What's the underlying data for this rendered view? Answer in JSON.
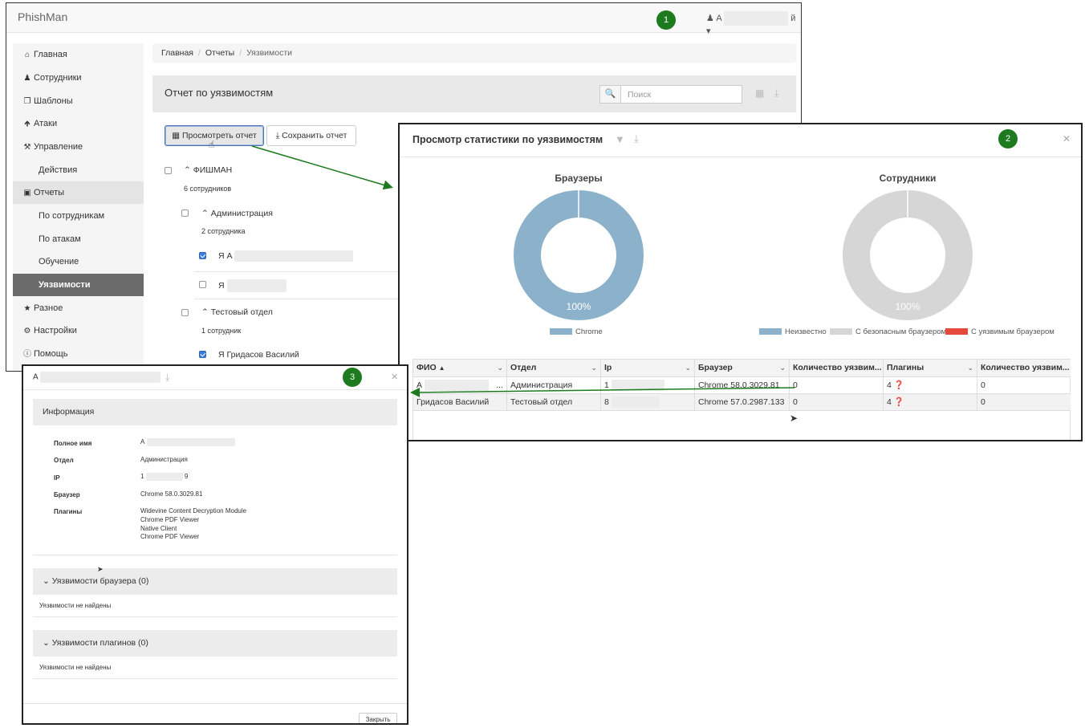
{
  "badges": [
    "1",
    "2",
    "3"
  ],
  "window1": {
    "brand": "PhishMan",
    "user": {
      "prefix": "A",
      "suffix": "й"
    },
    "sidebar": {
      "items": [
        {
          "label": "Главная",
          "icon": "home-icon"
        },
        {
          "label": "Сотрудники",
          "icon": "users-icon"
        },
        {
          "label": "Шаблоны",
          "icon": "templates-icon"
        },
        {
          "label": "Атаки",
          "icon": "arrow-up-icon"
        },
        {
          "label": "Управление",
          "icon": "wrench-icon"
        },
        {
          "label": "Действия"
        },
        {
          "label": "Отчеты",
          "icon": "book-icon"
        },
        {
          "label": "По сотрудникам"
        },
        {
          "label": "По атакам"
        },
        {
          "label": "Обучение"
        },
        {
          "label": "Уязвимости"
        },
        {
          "label": "Разное",
          "icon": "star-icon"
        },
        {
          "label": "Настройки",
          "icon": "cogs-icon"
        },
        {
          "label": "Помощь",
          "icon": "info-icon"
        }
      ]
    },
    "breadcrumb": [
      "Главная",
      "Отчеты",
      "Уязвимости"
    ],
    "panel_title": "Отчет по уязвимостям",
    "search_placeholder": "Поиск",
    "buttons": {
      "view": "Просмотреть отчет",
      "save": "Сохранить отчет"
    },
    "tree": {
      "org": "ФИШМАН",
      "org_count": "6 сотрудников",
      "dept1": "Администрация",
      "dept1_count": "2 сотрудника",
      "user1_prefix": "А",
      "dept2": "Тестовый отдел",
      "dept2_count": "1 сотрудник",
      "user3": "Гридасов Василий"
    }
  },
  "window2": {
    "title": "Просмотр статистики по уязвимостям",
    "chart_data": [
      {
        "type": "pie",
        "title": "Браузеры",
        "categories": [
          "Chrome"
        ],
        "values": [
          100
        ],
        "label": "100%",
        "colors": [
          "#8cb2cb"
        ]
      },
      {
        "type": "pie",
        "title": "Сотрудники",
        "categories": [
          "Неизвестно",
          "С безопасным браузером",
          "С уязвимым браузером"
        ],
        "values": [
          0,
          100,
          0
        ],
        "label": "100%",
        "colors": [
          "#8cb2cb",
          "#d6d6d6",
          "#e8483a"
        ]
      }
    ],
    "table": {
      "columns": [
        "ФИО",
        "Отдел",
        "Ip",
        "Браузер",
        "Количество уязвим...",
        "Плагины",
        "Количество уязвим..."
      ],
      "sort_indicator": "▲",
      "rows": [
        [
          "А",
          "Администрация",
          "1",
          "Chrome 58.0.3029.81",
          "0",
          "4",
          "0"
        ],
        [
          "Гридасов Василий",
          "Тестовый отдел",
          "8",
          "Chrome 57.0.2987.133",
          "0",
          "4",
          "0"
        ]
      ],
      "ellipsis": "..."
    }
  },
  "window3": {
    "title_prefix": "А",
    "info_section": "Информация",
    "fields": [
      {
        "key": "Полное имя",
        "value": "А"
      },
      {
        "key": "Отдел",
        "value": "Администрация"
      },
      {
        "key": "IP",
        "value": "1"
      },
      {
        "key": "Браузер",
        "value": "Chrome 58.0.3029.81"
      },
      {
        "key": "Плагины",
        "value": ""
      }
    ],
    "ip_suffix": "9",
    "plugins": [
      "Widevine Content Decryption Module",
      "Chrome PDF Viewer",
      "Native Client",
      "Chrome PDF Viewer"
    ],
    "browser_vulns": "Уязвимости браузера (0)",
    "plugin_vulns": "Уязвимости плагинов (0)",
    "none_found": "Уязвимости не найдены",
    "close": "Закрыть"
  }
}
